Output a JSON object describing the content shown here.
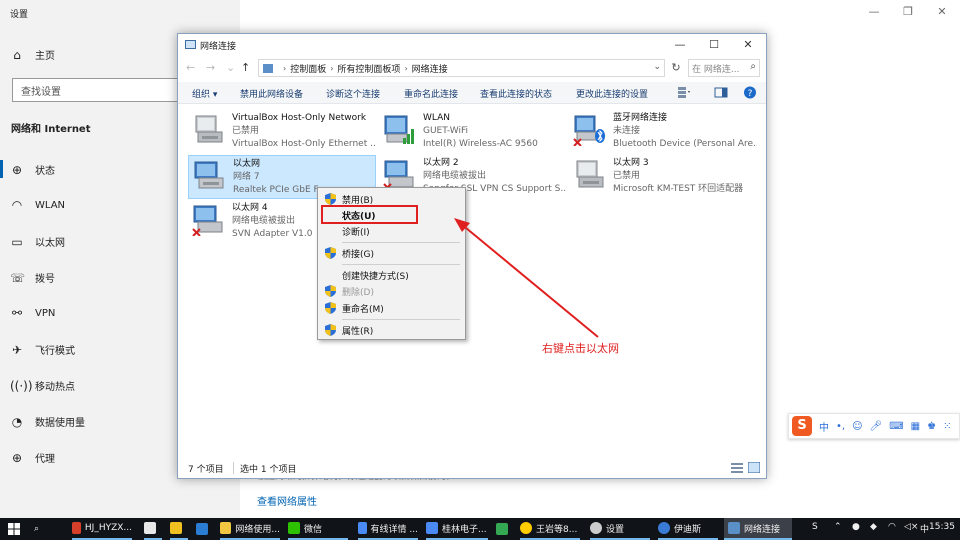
{
  "settings": {
    "window_title": "设置",
    "home_label": "主页",
    "search_placeholder": "查找设置",
    "section_title": "网络和 Internet",
    "nav_items": [
      {
        "label": "状态",
        "icon": "home-globe-icon"
      },
      {
        "label": "WLAN",
        "icon": "wifi-icon"
      },
      {
        "label": "以太网",
        "icon": "ethernet-icon"
      },
      {
        "label": "拨号",
        "icon": "dialup-icon"
      },
      {
        "label": "VPN",
        "icon": "vpn-icon"
      },
      {
        "label": "飞行模式",
        "icon": "airplane-icon"
      },
      {
        "label": "移动热点",
        "icon": "hotspot-icon"
      },
      {
        "label": "数据使用量",
        "icon": "data-usage-icon"
      },
      {
        "label": "代理",
        "icon": "globe-icon"
      }
    ],
    "bottom_partial_text": "根据网络的拆扑结构，你还是要为项目做目前的。",
    "link_text": "查看网络属性"
  },
  "explorer": {
    "title": "网络连接",
    "address": [
      "控制面板",
      "所有控制面板项",
      "网络连接"
    ],
    "search_placeholder": "在 网络连...",
    "toolbar": {
      "organize": "组织 ▾",
      "disable": "禁用此网络设备",
      "diagnose": "诊断这个连接",
      "rename": "重命名此连接",
      "view_status": "查看此连接的状态",
      "change_settings": "更改此连接的设置"
    },
    "adapters": [
      {
        "name": "VirtualBox Host-Only Network",
        "status": "已禁用",
        "device": "VirtualBox Host-Only Ethernet ...",
        "icon": "ethernet-adapter-icon",
        "disabled": true
      },
      {
        "name": "WLAN",
        "status": "GUET-WiFi",
        "device": "Intel(R) Wireless-AC 9560",
        "icon": "wifi-adapter-icon"
      },
      {
        "name": "蓝牙网络连接",
        "status": "未连接",
        "device": "Bluetooth Device (Personal Are...",
        "icon": "bluetooth-adapter-icon",
        "error": true
      },
      {
        "name": "以太网",
        "status": "网络 7",
        "device": "Realtek PCIe GbE Fa...",
        "icon": "ethernet-adapter-icon",
        "selected": true
      },
      {
        "name": "以太网 2",
        "status": "网络电缆被拔出",
        "device": "Sangfor SSL VPN CS Support S...",
        "icon": "ethernet-adapter-icon",
        "error": true
      },
      {
        "name": "以太网 3",
        "status": "已禁用",
        "device": "Microsoft KM-TEST 环回适配器",
        "icon": "ethernet-adapter-icon",
        "disabled": true
      },
      {
        "name": "以太网 4",
        "status": "网络电缆被拔出",
        "device": "SVN Adapter V1.0",
        "icon": "ethernet-adapter-icon",
        "error": true
      }
    ],
    "status_count": "7 个项目",
    "status_selected": "选中 1 个项目"
  },
  "context_menu": {
    "items": [
      {
        "label": "禁用(B)",
        "shield": true
      },
      {
        "label": "状态(U)",
        "bold": true
      },
      {
        "label": "诊断(I)"
      },
      {
        "label": "桥接(G)",
        "shield": true
      },
      {
        "label": "创建快捷方式(S)"
      },
      {
        "label": "删除(D)",
        "shield": true,
        "disabled": true
      },
      {
        "label": "重命名(M)",
        "shield": true
      },
      {
        "label": "属性(R)",
        "shield": true
      }
    ]
  },
  "annotation": {
    "text": "右键点击以太网",
    "color": "#e02020"
  },
  "ime": {
    "logo": "S",
    "mode": "中"
  },
  "taskbar": {
    "items": [
      {
        "label": "HJ_HYZX...",
        "color": "#d6402b"
      },
      {
        "label": "",
        "color": "#e8e8e8"
      },
      {
        "label": "",
        "color": "#f0c020"
      },
      {
        "label": "",
        "color": "#2b7cd3"
      },
      {
        "label": "网络使用...",
        "color": "#f3c642"
      },
      {
        "label": "微信",
        "color": "#2dc100"
      },
      {
        "label": "有线详情 ...",
        "color": "#4a8af4"
      },
      {
        "label": "桂林电子...",
        "color": "#4a8af4"
      },
      {
        "label": "",
        "color": "#34a853"
      },
      {
        "label": "王岩等8...",
        "color": "#ffcc00"
      },
      {
        "label": "设置",
        "color": "#cccccc"
      },
      {
        "label": "伊迪斯",
        "color": "#3a7bd5"
      },
      {
        "label": "网络连接",
        "color": "#5b8fc7"
      }
    ],
    "tray_ime": "中",
    "clock": "15:35"
  },
  "colors": {
    "accent": "#0063b1",
    "selection": "#cce8ff",
    "highlight_red": "#e02020"
  }
}
